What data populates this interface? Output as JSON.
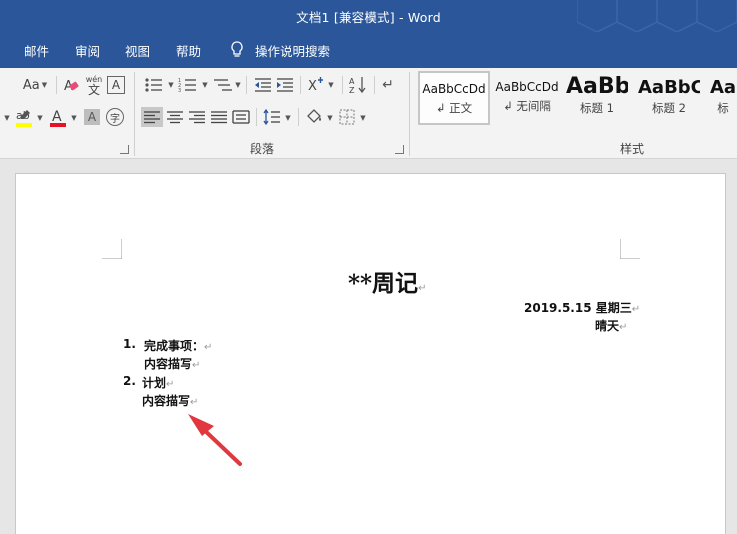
{
  "window": {
    "title": "文档1 [兼容模式]  -  Word"
  },
  "menu": {
    "items": [
      "邮件",
      "审阅",
      "视图",
      "帮助"
    ],
    "tell_me": "操作说明搜索"
  },
  "ribbon": {
    "font_size_label": "Aa",
    "pinyin_label": "wén",
    "pinyin_char": "文",
    "boxed_char": "A",
    "enclosed_char": "字",
    "paragraph_label": "段落",
    "styles_label": "样式",
    "styles": [
      {
        "sample": "AaBbCcDd",
        "name": "正文",
        "selected": true
      },
      {
        "sample": "AaBbCcDd",
        "name": "无间隔",
        "selected": false
      },
      {
        "sample": "AaBb",
        "name": "标题 1",
        "selected": false
      },
      {
        "sample": "AaBbC",
        "name": "标题 2",
        "selected": false
      },
      {
        "sample": "Aa",
        "name": "标",
        "selected": false
      }
    ]
  },
  "document": {
    "title": "**周记",
    "date_line": "2019.5.15  星期三",
    "weather": "晴天",
    "items": [
      {
        "number": "1.",
        "heading": "完成事项：",
        "content": "内容描写"
      },
      {
        "number": "2.",
        "heading": "计划",
        "content": "内容描写"
      }
    ],
    "paragraph_mark": "↵"
  },
  "colors": {
    "title_bar": "#2b579a",
    "highlight_yellow": "#ffff00",
    "font_color_red": "#e81123",
    "arrow_red": "#e0383e"
  }
}
